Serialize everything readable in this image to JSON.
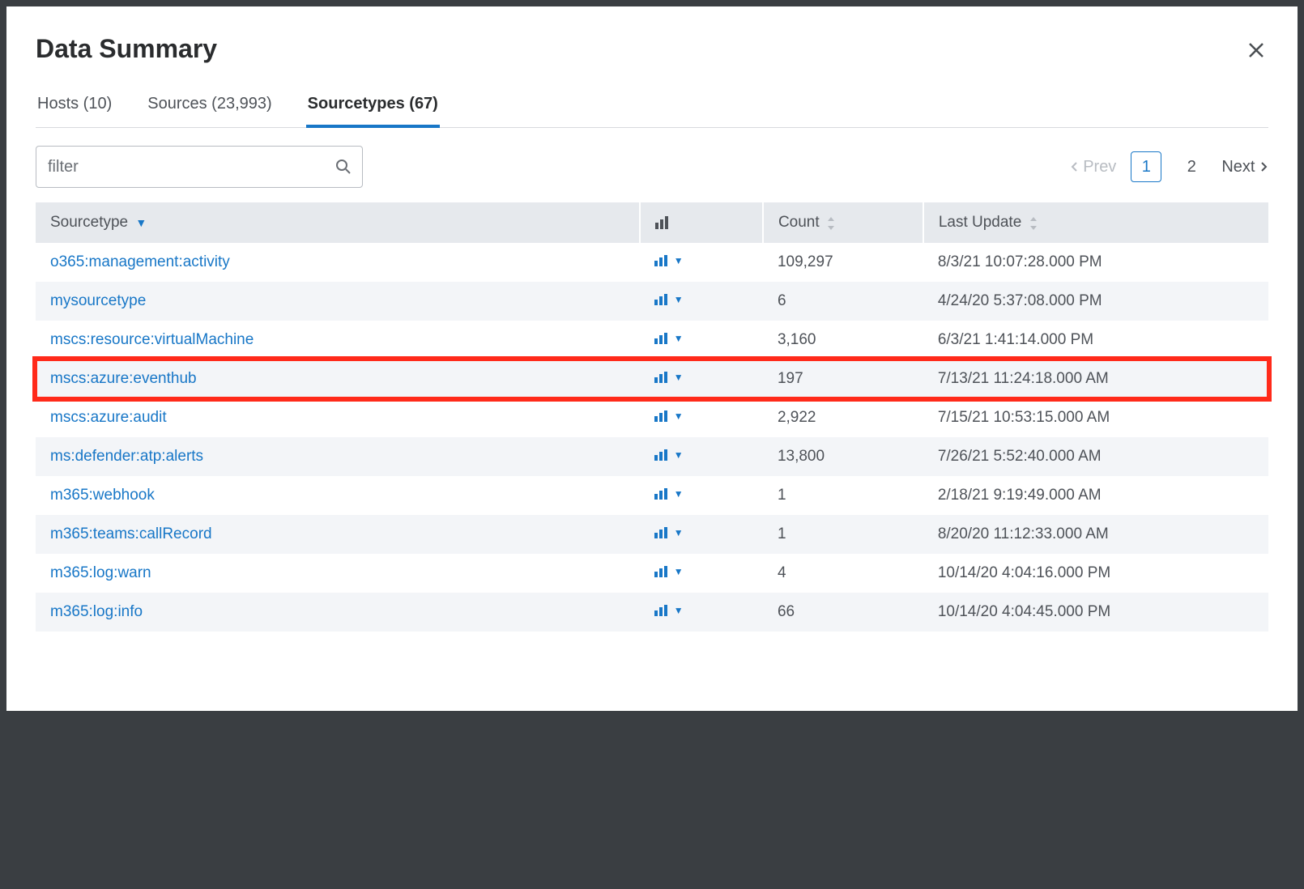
{
  "modal": {
    "title": "Data Summary"
  },
  "tabs": [
    {
      "label": "Hosts (10)",
      "active": false
    },
    {
      "label": "Sources (23,993)",
      "active": false
    },
    {
      "label": "Sourcetypes (67)",
      "active": true
    }
  ],
  "filter": {
    "placeholder": "filter"
  },
  "pagination": {
    "prev": "Prev",
    "next": "Next",
    "pages": [
      "1",
      "2"
    ],
    "current": "1"
  },
  "columns": {
    "sourcetype": "Sourcetype",
    "count": "Count",
    "last_update": "Last Update"
  },
  "rows": [
    {
      "name": "o365:management:activity",
      "count": "109,297",
      "update": "8/3/21 10:07:28.000 PM",
      "hl": false
    },
    {
      "name": "mysourcetype",
      "count": "6",
      "update": "4/24/20 5:37:08.000 PM",
      "hl": false
    },
    {
      "name": "mscs:resource:virtualMachine",
      "count": "3,160",
      "update": "6/3/21 1:41:14.000 PM",
      "hl": false
    },
    {
      "name": "mscs:azure:eventhub",
      "count": "197",
      "update": "7/13/21 11:24:18.000 AM",
      "hl": true
    },
    {
      "name": "mscs:azure:audit",
      "count": "2,922",
      "update": "7/15/21 10:53:15.000 AM",
      "hl": false
    },
    {
      "name": "ms:defender:atp:alerts",
      "count": "13,800",
      "update": "7/26/21 5:52:40.000 AM",
      "hl": false
    },
    {
      "name": "m365:webhook",
      "count": "1",
      "update": "2/18/21 9:19:49.000 AM",
      "hl": false
    },
    {
      "name": "m365:teams:callRecord",
      "count": "1",
      "update": "8/20/20 11:12:33.000 AM",
      "hl": false
    },
    {
      "name": "m365:log:warn",
      "count": "4",
      "update": "10/14/20 4:04:16.000 PM",
      "hl": false
    },
    {
      "name": "m365:log:info",
      "count": "66",
      "update": "10/14/20 4:04:45.000 PM",
      "hl": false
    }
  ]
}
